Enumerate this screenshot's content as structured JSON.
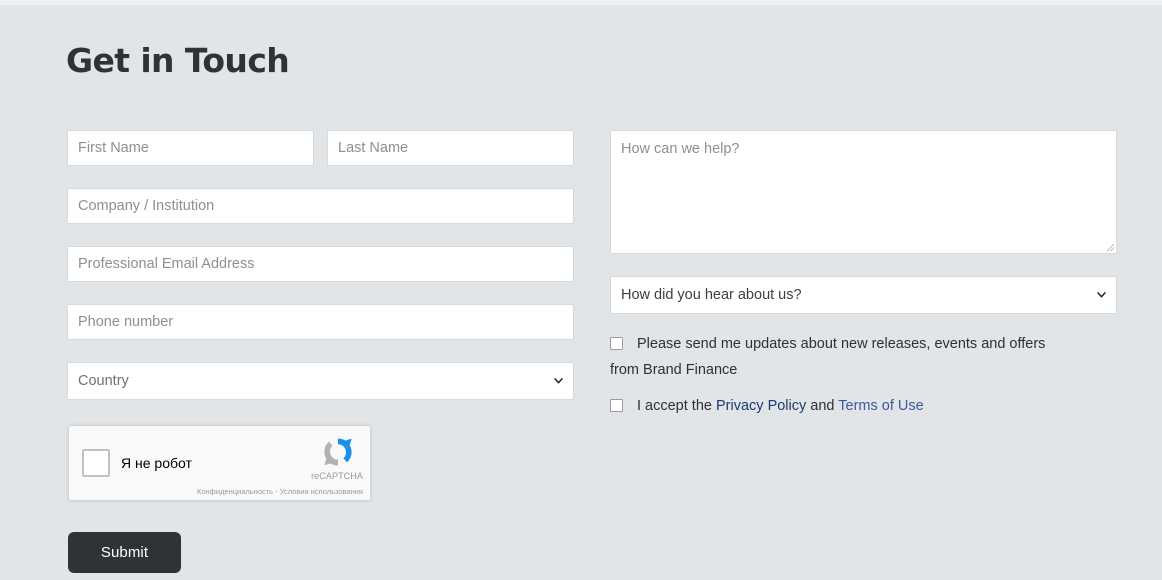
{
  "page": {
    "title": "Get in Touch",
    "background_color": "#e2e5e7"
  },
  "form": {
    "left_column": {
      "first_name": {
        "placeholder": "First Name",
        "value": ""
      },
      "last_name": {
        "placeholder": "Last Name",
        "value": ""
      },
      "company": {
        "placeholder": "Company / Institution",
        "value": ""
      },
      "email": {
        "placeholder": "Professional Email Address",
        "value": ""
      },
      "phone": {
        "placeholder": "Phone number",
        "value": ""
      },
      "country": {
        "selected": "Country",
        "options": [
          "Country"
        ]
      }
    },
    "right_column": {
      "message": {
        "placeholder": "How can we help?",
        "value": ""
      },
      "hear_about_us": {
        "selected": "How did you hear about us?",
        "options": [
          "How did you hear about us?"
        ]
      },
      "consent_updates": {
        "label_line1": "Please send me updates about new releases, events and offers",
        "label_line2": "from Brand Finance",
        "checked": false
      },
      "accept_terms": {
        "prefix": "I accept the ",
        "privacy_policy_link": "Privacy Policy",
        "conjunction": " and ",
        "terms_link": "Terms of Use",
        "checked": false,
        "privacy_policy_color": "#1c3a6e",
        "terms_color": "#3a5a9b"
      }
    },
    "recaptcha": {
      "label": "Я не робот",
      "brand": "reCAPTCHA",
      "terms": "Конфиденциальность - Условия использования",
      "checked": false
    },
    "submit_label": "Submit",
    "submit_color": "#2f3337"
  }
}
